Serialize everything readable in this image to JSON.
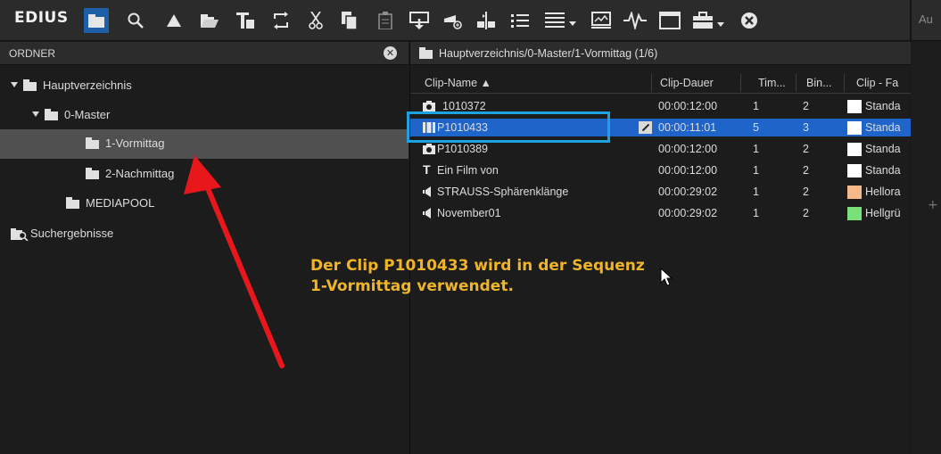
{
  "app": {
    "logo": "EDIUS",
    "toolbar_cut_text": "Au"
  },
  "colors": {
    "accent": "#1f64c8",
    "highlight_box": "#1aa3e0",
    "annotation": "#f0b429",
    "arrow": "#e8171c"
  },
  "toolbar": {
    "icons": [
      "folder-icon",
      "search-icon",
      "triangle-up-icon",
      "open-folder-icon",
      "title-icon",
      "sync-icon",
      "cut-icon",
      "copy-icon",
      "paste-icon",
      "insert-to-timeline-icon",
      "add-clip-icon",
      "split-icon",
      "list-view-icon",
      "detail-view-icon",
      "monitor-icon",
      "waveform-icon",
      "window-icon",
      "toolbox-icon",
      "close-icon"
    ]
  },
  "left_panel": {
    "title": "ORDNER",
    "tree": [
      {
        "label": "Hauptverzeichnis",
        "level": 0,
        "expanded": true
      },
      {
        "label": "0-Master",
        "level": 1,
        "expanded": true
      },
      {
        "label": "1-Vormittag",
        "level": 2,
        "selected": true
      },
      {
        "label": "2-Nachmittag",
        "level": 2
      },
      {
        "label": "MEDIAPOOL",
        "level": 1
      },
      {
        "label": "Suchergebnisse",
        "level": 0
      }
    ]
  },
  "right_panel": {
    "path": "Hauptverzeichnis/0-Master/1-Vormittag (1/6)",
    "columns": [
      "Clip-Name ▲",
      "Clip-Dauer",
      "Tim...",
      "Bin...",
      "Clip - Fa"
    ],
    "rows": [
      {
        "icon": "camera-icon",
        "name": "1010372",
        "dauer": "00:00:12:00",
        "tim": "1",
        "bin": "2",
        "farbe": "Standa",
        "swatch": "#ffffff"
      },
      {
        "icon": "video-clip-icon",
        "name": "P1010433",
        "dauer": "00:00:11:01",
        "tim": "5",
        "bin": "3",
        "farbe": "Standa",
        "swatch": "#ffffff",
        "selected": true
      },
      {
        "icon": "camera-icon",
        "name": "P1010389",
        "dauer": "00:00:12:00",
        "tim": "1",
        "bin": "2",
        "farbe": "Standa",
        "swatch": "#ffffff"
      },
      {
        "icon": "title-text-icon",
        "name": "Ein Film von",
        "dauer": "00:00:12:00",
        "tim": "1",
        "bin": "2",
        "farbe": "Standa",
        "swatch": "#ffffff"
      },
      {
        "icon": "audio-icon",
        "name": "STRAUSS-Sphärenklänge",
        "dauer": "00:00:29:02",
        "tim": "1",
        "bin": "2",
        "farbe": "Hellora",
        "swatch": "#f5b98a"
      },
      {
        "icon": "audio-icon",
        "name": "November01",
        "dauer": "00:00:29:02",
        "tim": "1",
        "bin": "2",
        "farbe": "Hellgrü",
        "swatch": "#7ae07a"
      }
    ]
  },
  "annotation": {
    "line1": "Der Clip P1010433 wird in der Sequenz",
    "line2": "1-Vormittag verwendet."
  }
}
